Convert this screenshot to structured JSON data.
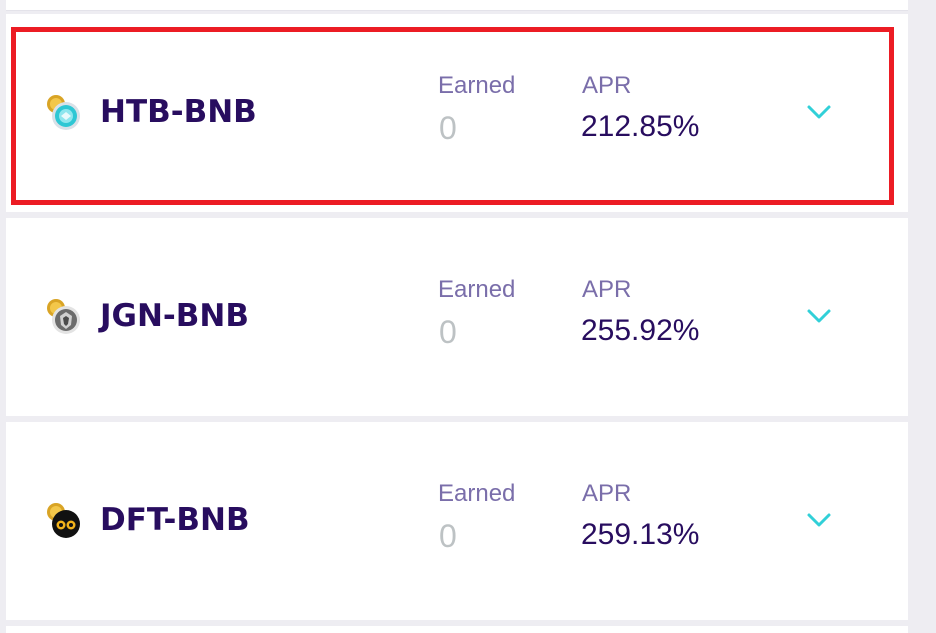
{
  "farms": [
    {
      "pair": "HTB-BNB",
      "icon": "htb-token-icon",
      "earned_label": "Earned",
      "earned": "0",
      "apr_label": "APR",
      "apr": "212.85%"
    },
    {
      "pair": "JGN-BNB",
      "icon": "jgn-token-icon",
      "earned_label": "Earned",
      "earned": "0",
      "apr_label": "APR",
      "apr": "255.92%"
    },
    {
      "pair": "DFT-BNB",
      "icon": "dft-token-icon",
      "earned_label": "Earned",
      "earned": "0",
      "apr_label": "APR",
      "apr": "259.13%"
    }
  ],
  "colors": {
    "highlight": "#ec1c24",
    "pair_text": "#280d5f",
    "label_text": "#7a6eaa",
    "muted_value": "#bdc2c4",
    "chevron": "#31d0d8"
  }
}
